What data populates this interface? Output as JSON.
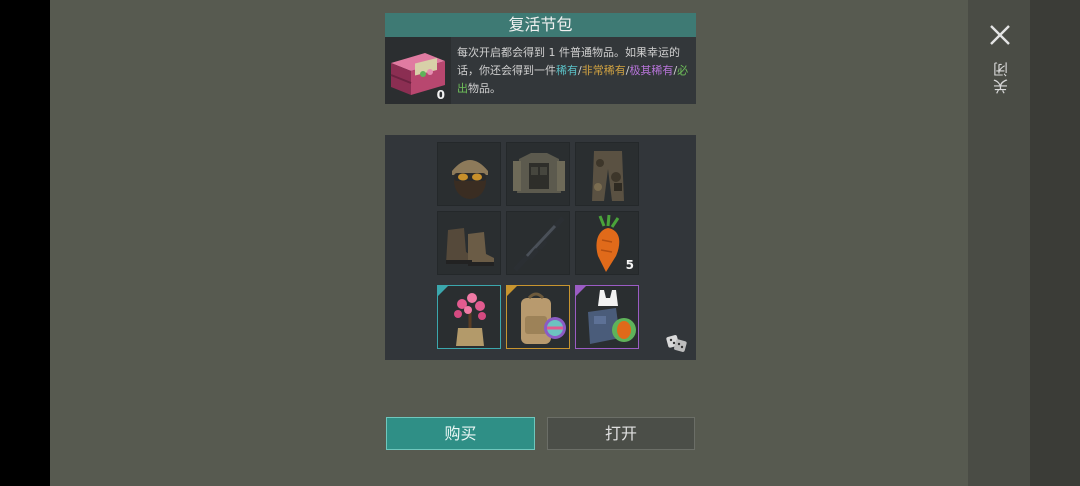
{
  "close": {
    "label": "关闭",
    "icon": "close-icon"
  },
  "pack": {
    "title": "复活节包",
    "count": "0",
    "icon": "easter-crate-icon",
    "desc": {
      "line_part1": "每次开启都会得到 1 件普通物品。如果幸运的话，你还会得到一件",
      "rare": "稀有",
      "sep1": "/",
      "very_rare": "非常稀有",
      "sep2": "/",
      "epic": "极其稀有",
      "sep3": "/",
      "must": "必出",
      "line_end": "物品。"
    }
  },
  "loot": {
    "items": [
      {
        "name": "helmet-goggles-icon",
        "qty": ""
      },
      {
        "name": "tactical-vest-icon",
        "qty": ""
      },
      {
        "name": "camo-pants-icon",
        "qty": ""
      },
      {
        "name": "combat-boots-icon",
        "qty": ""
      },
      {
        "name": "assault-rifle-icon",
        "qty": ""
      },
      {
        "name": "carrot-grenade-icon",
        "qty": "5"
      },
      {
        "name": "blossom-tree-sack-icon",
        "qty": "",
        "rarity": "rare"
      },
      {
        "name": "easter-backpack-icon",
        "qty": "",
        "rarity": "very-rare"
      },
      {
        "name": "easter-outfit-icon",
        "qty": "",
        "rarity": "epic"
      }
    ],
    "random_icon": "dice-icon"
  },
  "buttons": {
    "buy": "购买",
    "open": "打开"
  },
  "colors": {
    "rare": "#5bc1c7",
    "very_rare": "#d2a342",
    "epic": "#b774d9",
    "must": "#6fc05a",
    "accent": "#2f8f86"
  }
}
